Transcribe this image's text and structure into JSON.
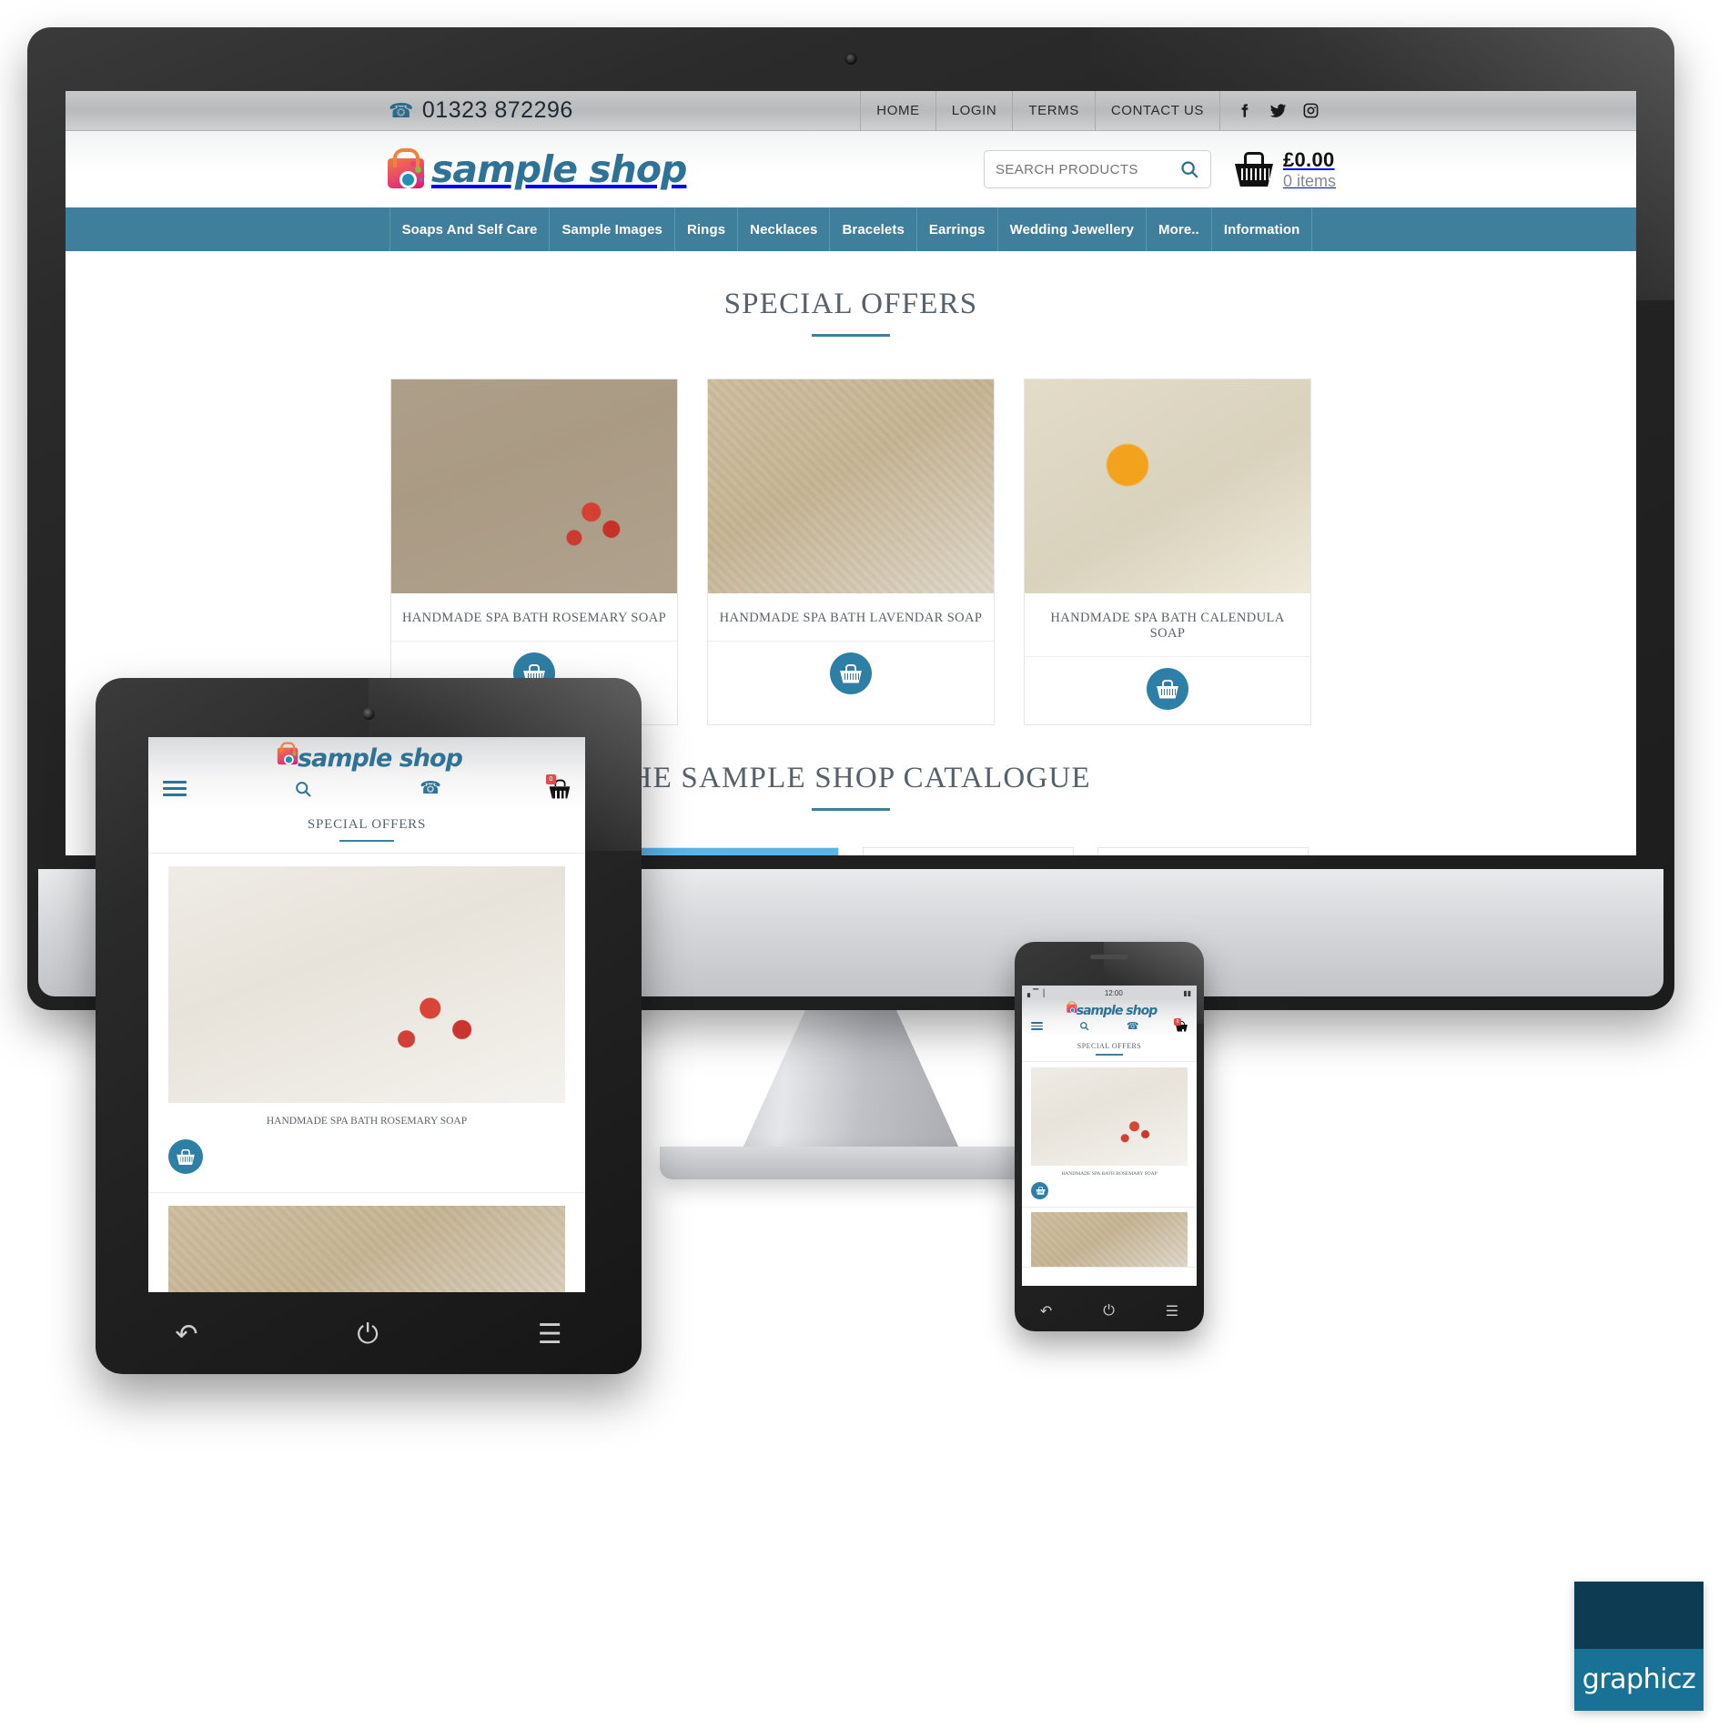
{
  "site": {
    "phone": "01323 872296",
    "brand": "sample shop",
    "top_nav": [
      {
        "label": "HOME"
      },
      {
        "label": "LOGIN"
      },
      {
        "label": "TERMS"
      },
      {
        "label": "CONTACT US"
      }
    ],
    "social": [
      {
        "name": "facebook-icon"
      },
      {
        "name": "twitter-icon"
      },
      {
        "name": "instagram-icon"
      }
    ],
    "search": {
      "placeholder": "SEARCH PRODUCTS",
      "value": ""
    },
    "cart": {
      "amount": "£0.00",
      "items": "0 items",
      "count": "0"
    },
    "main_nav": [
      {
        "label": "Soaps And Self Care"
      },
      {
        "label": "Sample Images"
      },
      {
        "label": "Rings"
      },
      {
        "label": "Necklaces"
      },
      {
        "label": "Bracelets"
      },
      {
        "label": "Earrings"
      },
      {
        "label": "Wedding Jewellery"
      },
      {
        "label": "More.."
      },
      {
        "label": "Information"
      }
    ]
  },
  "sections": {
    "special_offers": {
      "title": "SPECIAL OFFERS",
      "products": [
        {
          "name": "HANDMADE SPA BATH ROSEMARY SOAP"
        },
        {
          "name": "HANDMADE SPA BATH LAVENDAR SOAP"
        },
        {
          "name": "HANDMADE SPA BATH CALENDULA SOAP"
        }
      ]
    },
    "catalogue": {
      "title": "THE SAMPLE SHOP CATALOGUE",
      "items": [
        {
          "name": "catalogue-item-craft"
        },
        {
          "name": "catalogue-item-tulips"
        },
        {
          "name": "catalogue-item-ring"
        },
        {
          "name": "catalogue-item-necklace"
        }
      ]
    }
  },
  "devices": {
    "desktop": {
      "label": "imac-desktop-mockup"
    },
    "tablet": {
      "label": "tablet-mockup",
      "nav": [
        "↶",
        "⏻",
        "☰"
      ]
    },
    "phone": {
      "label": "phone-mockup",
      "time": "12:00",
      "nav": [
        "↶",
        "⏻",
        "☰"
      ]
    }
  },
  "watermark": {
    "text": "graphicz",
    "top_color": "#0d3b51",
    "bottom_color": "#1a7196"
  },
  "colors": {
    "brand_blue": "#2e7296",
    "nav_blue": "#3f7f9c",
    "accent_pink": "#d81b6a",
    "heading_gray": "#55616b"
  }
}
